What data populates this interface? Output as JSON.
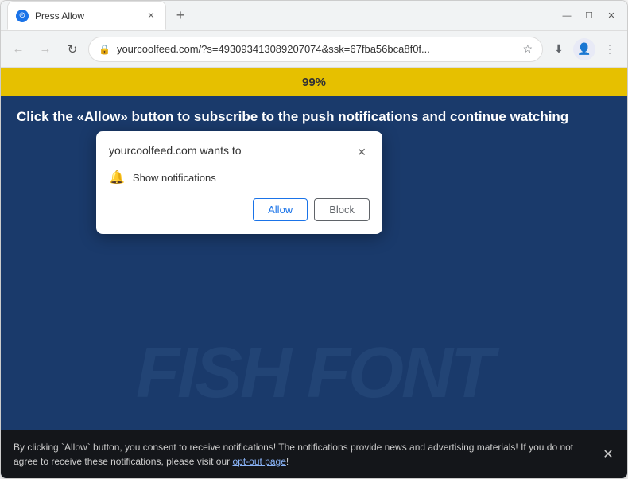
{
  "browser": {
    "tab": {
      "title": "Press Allow",
      "favicon_char": "⊙"
    },
    "new_tab_btn": "+",
    "window_controls": {
      "minimize": "—",
      "maximize": "☐",
      "close": "✕"
    },
    "nav": {
      "back_btn": "←",
      "forward_btn": "→",
      "refresh_btn": "↻",
      "address": "yourcoolfeed.com/?s=493093413089207074&ssk=67fba56bca8f0f...",
      "address_lock": "🔒",
      "profile_char": "👤",
      "download_icon": "⬇",
      "menu_icon": "⋮"
    }
  },
  "notification_popup": {
    "title": "yourcoolfeed.com wants to",
    "close_char": "✕",
    "notification_row": {
      "icon": "🔔",
      "label": "Show notifications"
    },
    "allow_btn": "Allow",
    "block_btn": "Block"
  },
  "page": {
    "progress_text": "99%",
    "main_message": "Click the «Allow» button to subscribe to the push notifications and continue watching",
    "watermark": "FISH FONT",
    "background_color": "#1a3a6b"
  },
  "consent_bar": {
    "text_before_link": "By clicking `Allow` button, you consent to receive notifications! The notifications provide news and advertising materials! If you do not agree to receive these notifications, please visit our ",
    "link_text": "opt-out page",
    "text_after_link": "!",
    "close_char": "✕"
  }
}
